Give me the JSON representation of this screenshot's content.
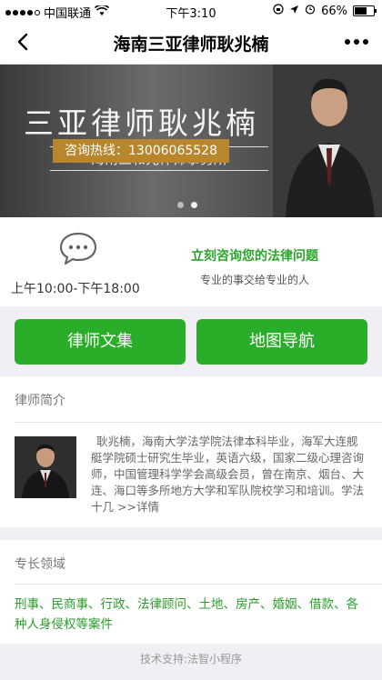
{
  "status_bar": {
    "carrier": "中国联通",
    "time": "下午3:10",
    "battery": "66%"
  },
  "nav": {
    "title": "海南三亚律师耿兆楠"
  },
  "banner": {
    "title": "三亚律师耿兆楠",
    "firm": "海南三和元律师事务所",
    "hotline": "咨询热线：13006065528",
    "slide_index": 1,
    "slide_count": 2
  },
  "consult": {
    "hours": "上午10:00-下午18:00",
    "title": "立刻咨询您的法律问题",
    "subtitle": "专业的事交给专业的人"
  },
  "buttons": {
    "articles": "律师文集",
    "map": "地图导航"
  },
  "bio": {
    "heading": "律师简介",
    "text": "耿兆楠，海南大学法学院法律本科毕业，海军大连舰艇学院硕士研究生毕业，英语六级，国家二级心理咨询师，中国管理科学学会高级会员，曾在南京、烟台、大连、海口等多所地方大学和军队院校学习和培训。学法十几",
    "more": ">>详情"
  },
  "specialty": {
    "heading": "专长领域",
    "text": "刑事、民商事、行政、法律顾问、土地、房产、婚姻、借款、各种人身侵权等案件"
  },
  "footer": {
    "text": "技术支持:法智小程序"
  },
  "colors": {
    "accent_green": "#2aae2a",
    "hotline_gold": "#b8862d"
  }
}
